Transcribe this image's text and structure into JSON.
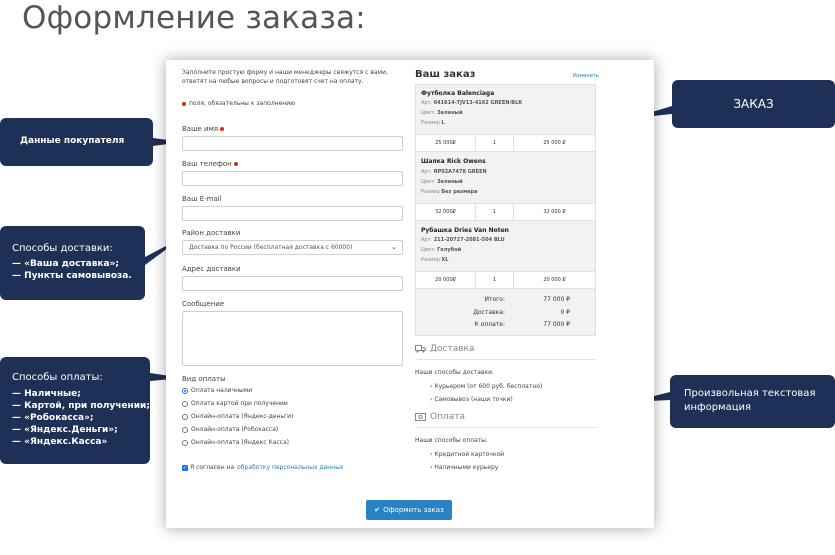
{
  "page_title": "Оформление заказа:",
  "form": {
    "intro": "Заполните простую форму и наши менеджеры свяжутся с вами, ответят на любые вопросы и подготовят счет на оплату.",
    "required_note": "поля, обязательны к заполнению",
    "name_label": "Ваше имя",
    "phone_label": "Ваш телефон",
    "email_label": "Ваш E-mail",
    "region_label": "Район доставки",
    "region_value": "Доставка по России (бесплатная доставка с 60000)",
    "address_label": "Адрес доставки",
    "message_label": "Сообщение",
    "payment_label": "Вид оплаты",
    "payment_options": [
      "Оплата наличными",
      "Оплата картой при получении",
      "Онлайн-оплата (Яндекс-деньги)",
      "Онлайн-оплата (Робокасса)",
      "Онлайн-оплата (Яндекс Касса)"
    ],
    "agree_text": "Я согласен на",
    "agree_link": "обработку персональных данных",
    "submit_label": "Оформить заказ"
  },
  "order": {
    "title": "Ваш заказ",
    "edit_label": "Изменить",
    "items": [
      {
        "name": "Футболка Balenciaga",
        "art_label": "Арт.",
        "art": "641614-TJV13-4162 GREEN/BLK",
        "color_label": "Цвет:",
        "color": "Зеленый",
        "size_label": "Размер",
        "size": "L",
        "price": "25 000₽",
        "qty": "1",
        "sum": "25 000 ₽"
      },
      {
        "name": "Шапка Rick Owens",
        "art_label": "Арт.",
        "art": "RP02A7478 GREEN",
        "color_label": "Цвет:",
        "color": "Зеленый",
        "size_label": "Размер",
        "size": "Без размера",
        "price": "32 000₽",
        "qty": "1",
        "sum": "32 000 ₽"
      },
      {
        "name": "Рубашка Dries Van Noten",
        "art_label": "Арт.",
        "art": "211-20727-2081-504 BLU",
        "color_label": "Цвет:",
        "color": "Голубой",
        "size_label": "Размер",
        "size": "XL",
        "price": "20 000₽",
        "qty": "1",
        "sum": "20 000 ₽"
      }
    ],
    "totals": [
      {
        "label": "Итого:",
        "value": "77 000 ₽"
      },
      {
        "label": "Доставка:",
        "value": "0 ₽"
      },
      {
        "label": "К оплате:",
        "value": "77 000 ₽"
      }
    ]
  },
  "delivery": {
    "heading": "Доставка",
    "text": "Наши способы доставки.",
    "items": [
      "Курьером (от 600 руб. бесплатно)",
      "Самовывоз (наши точки)"
    ]
  },
  "payment_info": {
    "heading": "Оплата",
    "text": "Наши способы оплаты.",
    "items": [
      "Кредитной карточкой",
      "Наличными курьеру"
    ]
  },
  "callouts": {
    "buyer": "Данные покупателя",
    "order": "ЗАКАЗ",
    "delivery_title": "Способы доставки:",
    "delivery_lines": [
      "— «Ваша доставка»;",
      "— Пункты самовывоза."
    ],
    "payment_title": "Способы оплаты:",
    "payment_lines": [
      "— Наличные;",
      "— Картой, при получении;",
      "— «Робокасса»;",
      "— «Яндекс.Деньги»;",
      "— «Яндекс.Касса»"
    ],
    "text_info": "Произвольная текстовая информация"
  },
  "colors": {
    "callout_bg": "#1f3057",
    "accent": "#2a82c4",
    "required": "#e2231a"
  }
}
